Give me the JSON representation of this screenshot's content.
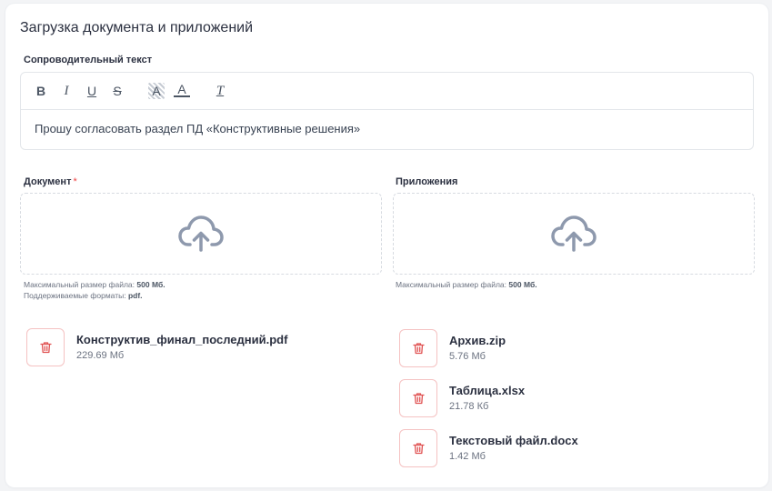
{
  "page": {
    "title": "Загрузка документа и приложений"
  },
  "editor": {
    "label": "Сопроводительный текст",
    "text": "Прошу согласовать раздел ПД «Конструктивные решения»",
    "toolbar": [
      {
        "name": "bold-icon",
        "glyph": "B"
      },
      {
        "name": "italic-icon",
        "glyph": "I"
      },
      {
        "name": "underline-icon",
        "glyph": "U"
      },
      {
        "name": "strikethrough-icon",
        "glyph": "S"
      },
      {
        "name": "highlight-icon",
        "glyph": "A"
      },
      {
        "name": "text-color-icon",
        "glyph": "A"
      },
      {
        "name": "clear-format-icon",
        "glyph": "T"
      }
    ]
  },
  "document": {
    "label": "Документ",
    "required_mark": "*",
    "hint_size_label": "Максимальный размер файла:",
    "hint_size_value": "500 Мб.",
    "hint_formats_label": "Поддерживаемые форматы:",
    "hint_formats_value": "pdf.",
    "files": [
      {
        "name": "Конструктив_финал_последний.pdf",
        "size": "229.69 Мб"
      }
    ]
  },
  "attachments": {
    "label": "Приложения",
    "hint_size_label": "Максимальный размер файла:",
    "hint_size_value": "500 Мб.",
    "files": [
      {
        "name": "Архив.zip",
        "size": "5.76 Мб"
      },
      {
        "name": "Таблица.xlsx",
        "size": "21.78 Кб"
      },
      {
        "name": "Текстовый файл.docx",
        "size": "1.42 Мб"
      }
    ]
  },
  "colors": {
    "icon": "#8e99ad",
    "delete": "#e05252",
    "required": "#ef4444"
  }
}
